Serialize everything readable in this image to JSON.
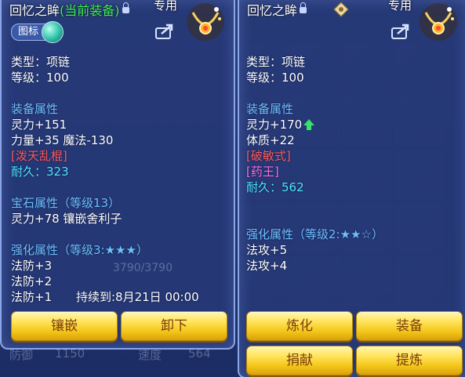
{
  "left_panel": {
    "title": "回忆之眸",
    "title_status": "(当前装备)",
    "exclusive_label": "专用",
    "tag_label": "图标",
    "type_line": "类型：项链",
    "level_line": "等级：100",
    "equip_attr_header": "装备属性",
    "stat_1": "灵力+151",
    "stat_2": "力量+35 魔法-130",
    "special_1": "[泼天乱棍]",
    "durability": "耐久：323",
    "gem_header": "宝石属性（等级13）",
    "gem_line": "灵力+78 镶嵌舍利子",
    "enhance_header": "强化属性（等级3:★★★）",
    "enhance_1": "法防+3",
    "enhance_2": "法防+2",
    "enhance_3": "法防+1",
    "duration": "持续到:8月21日 00:00",
    "buttons": {
      "inlay": "镶嵌",
      "unequip": "卸下"
    }
  },
  "right_panel": {
    "title": "回忆之眸",
    "exclusive_label": "专用",
    "type_line": "类型：项链",
    "level_line": "等级：100",
    "equip_attr_header": "装备属性",
    "stat_1": "灵力+170",
    "stat_2": "体质+22",
    "special_1": "[破敏式]",
    "special_2": "[药王]",
    "durability": "耐久：562",
    "enhance_header": "强化属性（等级2:★★☆）",
    "enhance_1": "法攻+5",
    "enhance_2": "法攻+4",
    "buttons": {
      "refine": "炼化",
      "equip": "装备",
      "donate": "捐献",
      "purify": "提炼"
    }
  },
  "background": {
    "hp_text": "3790/3790",
    "defense_label": "防御",
    "defense_value": "1150",
    "speed_label": "速度",
    "speed_value": "564"
  },
  "colors": {
    "header_blue": "#6ec0ff",
    "special_red": "#ff5a5a",
    "durability_cyan": "#4ee6ff",
    "special_pink": "#ff6ed8",
    "current_green": "#3cf05a",
    "button_gold": "#f3c518"
  }
}
